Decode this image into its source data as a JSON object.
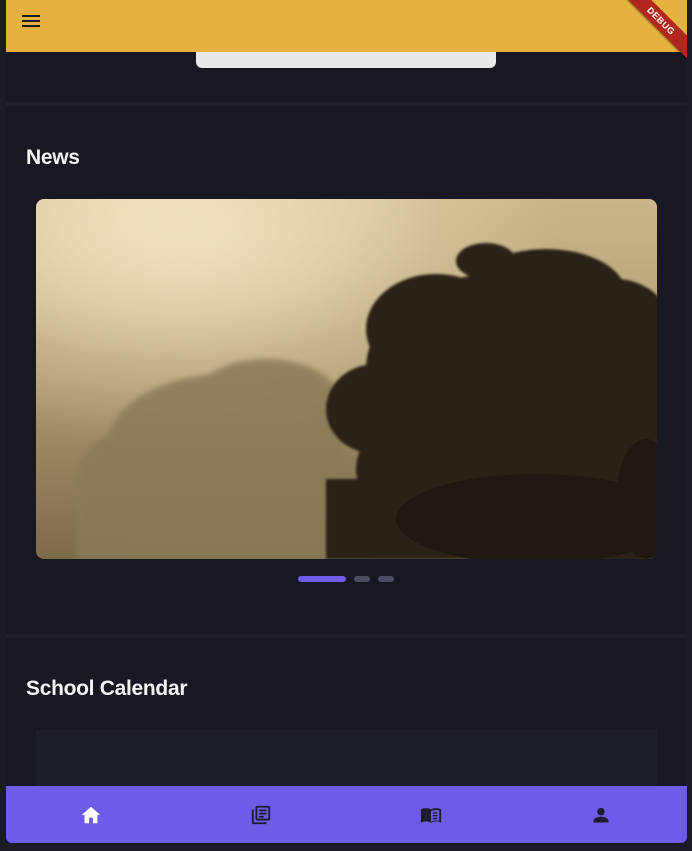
{
  "app": {
    "debug_label": "DEBUG",
    "accent_color": "#e6b23f",
    "nav_color": "#6c5ce7"
  },
  "appbar": {
    "menu_icon": "menu-icon"
  },
  "news": {
    "title": "News",
    "carousel": {
      "slide_count": 3,
      "active_index": 0
    }
  },
  "calendar": {
    "title": "School Calendar"
  },
  "bottom_nav": {
    "items": [
      {
        "icon": "home-icon",
        "active": true
      },
      {
        "icon": "news-icon",
        "active": false
      },
      {
        "icon": "book-icon",
        "active": false
      },
      {
        "icon": "person-icon",
        "active": false
      }
    ]
  }
}
